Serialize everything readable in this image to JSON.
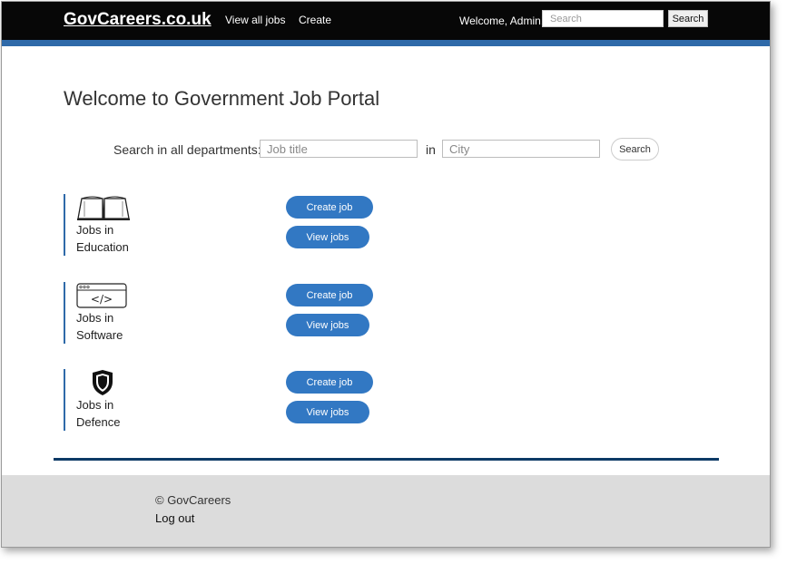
{
  "header": {
    "brand": "GovCareers.co.uk",
    "nav": [
      "View all jobs",
      "Create"
    ],
    "welcome": "Welcome, Admin!",
    "search_placeholder": "Search",
    "search_button": "Search"
  },
  "main": {
    "title": "Welcome to Government Job Portal",
    "search_label": "Search in all departments:",
    "job_title_placeholder": "Job title",
    "in_label": "in",
    "city_placeholder": "City",
    "search_button": "Search"
  },
  "categories": [
    {
      "line1": "Jobs in",
      "line2": "Education",
      "icon": "book-icon",
      "create": "Create job",
      "view": "View jobs"
    },
    {
      "line1": "Jobs in",
      "line2": "Software",
      "icon": "code-window-icon",
      "create": "Create job",
      "view": "View jobs"
    },
    {
      "line1": "Jobs in",
      "line2": "Defence",
      "icon": "shield-icon",
      "create": "Create job",
      "view": "View jobs"
    }
  ],
  "footer": {
    "copyright": "© GovCareers",
    "logout": "Log out"
  },
  "colors": {
    "header_bg": "#070707",
    "accent": "#2f6aa9",
    "button": "#3278c3",
    "footer_bg": "#dcdcdc"
  }
}
